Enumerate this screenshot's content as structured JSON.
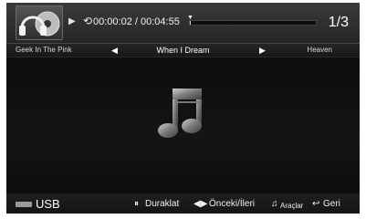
{
  "player": {
    "elapsed": "00:00:02",
    "separator": " / ",
    "duration": "00:04:55",
    "progress_fraction": 0.007,
    "track_counter": "1/3"
  },
  "tracks": {
    "previous": "Geek In The Pink",
    "current": "When I Dream",
    "next": "Heaven"
  },
  "footer": {
    "source_label": "USB",
    "pause_label": "Duraklat",
    "prev_next_label": "Önceki/İleri",
    "tools_label": "Araçlar",
    "back_label": "Geri"
  },
  "icons": {
    "thumbnail": "headphones-disc-icon",
    "play": "play-icon",
    "repeat": "repeat-icon",
    "art": "music-note-icon",
    "usb": "usb-icon"
  },
  "colors": {
    "background": "#0b0b0b",
    "topbar": "#303030",
    "text": "#ffffff",
    "progress_fill": "#cfcfcf"
  }
}
